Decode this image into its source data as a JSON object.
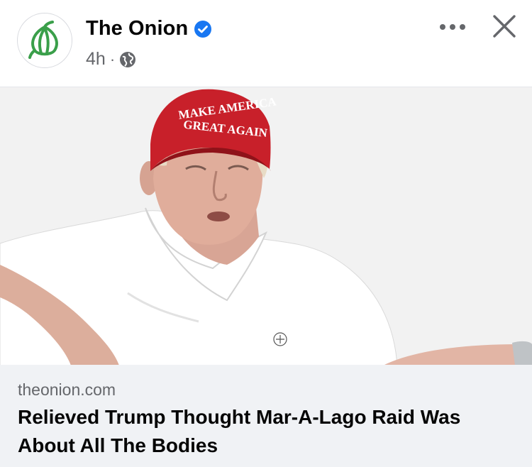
{
  "post": {
    "page_name": "The Onion",
    "verified": true,
    "time_ago": "4h",
    "separator": "·",
    "audience_icon": "globe-icon"
  },
  "actions": {
    "more_icon": "more-horizontal-icon",
    "close_icon": "close-icon"
  },
  "photo": {
    "subject": "man wearing a red cap and white polo shirt",
    "cap_text": "MAKE AMERICA GREAT AGAIN"
  },
  "link_preview": {
    "domain": "theonion.com",
    "title": "Relieved Trump Thought Mar-A-Lago Raid Was About All The Bodies"
  },
  "colors": {
    "brand_green": "#3a9f4a",
    "verified_blue": "#1877f2",
    "secondary_text": "#65676b",
    "preview_bg": "#f0f2f5",
    "cap_red": "#c8202a"
  }
}
